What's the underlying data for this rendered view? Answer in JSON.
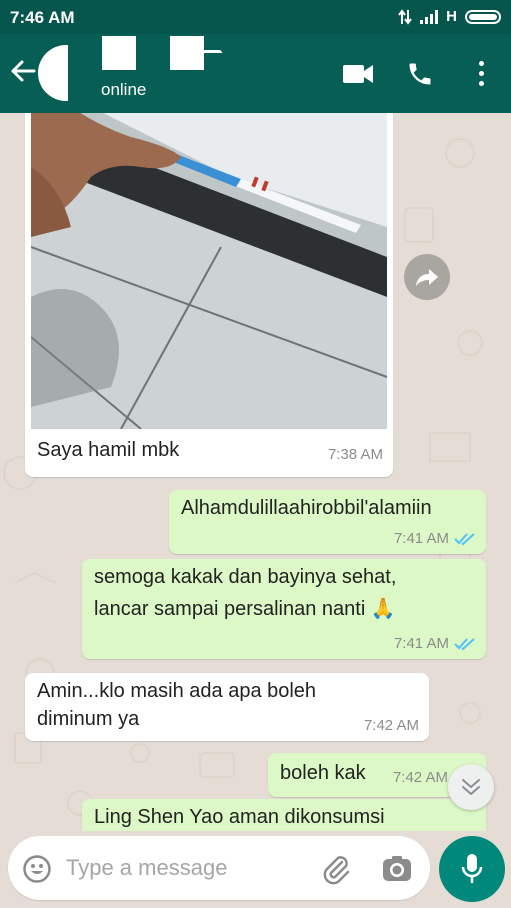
{
  "status_bar": {
    "time": "7:46 AM",
    "network": "H"
  },
  "header": {
    "contact_status": "online"
  },
  "messages": [
    {
      "direction": "in",
      "text": "Saya hamil mbk",
      "time": "7:38 AM",
      "has_image": true
    },
    {
      "direction": "out",
      "text": "Alhamdulillaahirobbil'alamiin",
      "time": "7:41 AM",
      "read": true
    },
    {
      "direction": "out",
      "lines": [
        "semoga kakak dan bayinya sehat,",
        "lancar sampai persalinan nanti 🙏"
      ],
      "time": "7:41 AM",
      "read": true
    },
    {
      "direction": "in",
      "lines": [
        "Amin...klo masih ada apa boleh",
        "diminum ya"
      ],
      "time": "7:42 AM"
    },
    {
      "direction": "out",
      "text": "boleh kak",
      "time": "7:42 AM"
    },
    {
      "direction": "out",
      "text": "Ling Shen Yao aman dikonsumsi"
    }
  ],
  "composer": {
    "placeholder": "Type a message"
  },
  "colors": {
    "header": "#075e54",
    "status_bar": "#06564d",
    "outgoing_bubble": "#dcf8c6",
    "incoming_bubble": "#ffffff",
    "read_ticks": "#4fc3f7",
    "mic_button": "#00897b",
    "background": "#e5ddd5"
  },
  "icons": [
    "back-arrow-icon",
    "video-call-icon",
    "phone-icon",
    "more-options-icon",
    "forward-icon",
    "double-check-icon",
    "scroll-down-icon",
    "emoji-icon",
    "attach-icon",
    "camera-icon",
    "mic-icon"
  ]
}
